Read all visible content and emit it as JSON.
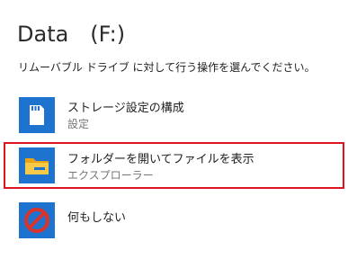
{
  "dialog": {
    "title": "Data　(F:)",
    "prompt": "リムーバブル ドライブ に対して行う操作を選んでください。"
  },
  "options": [
    {
      "label": "ストレージ設定の構成",
      "sub": "設定",
      "icon": "sd-card-icon"
    },
    {
      "label": "フォルダーを開いてファイルを表示",
      "sub": "エクスプローラー",
      "icon": "folder-icon",
      "highlighted": true
    },
    {
      "label": "何もしない",
      "sub": "",
      "icon": "no-action-icon"
    }
  ],
  "colors": {
    "tile": "#1e73cf",
    "highlight_border": "#e0141e",
    "folder": "#f7c948",
    "no_action": "#d9342b"
  }
}
